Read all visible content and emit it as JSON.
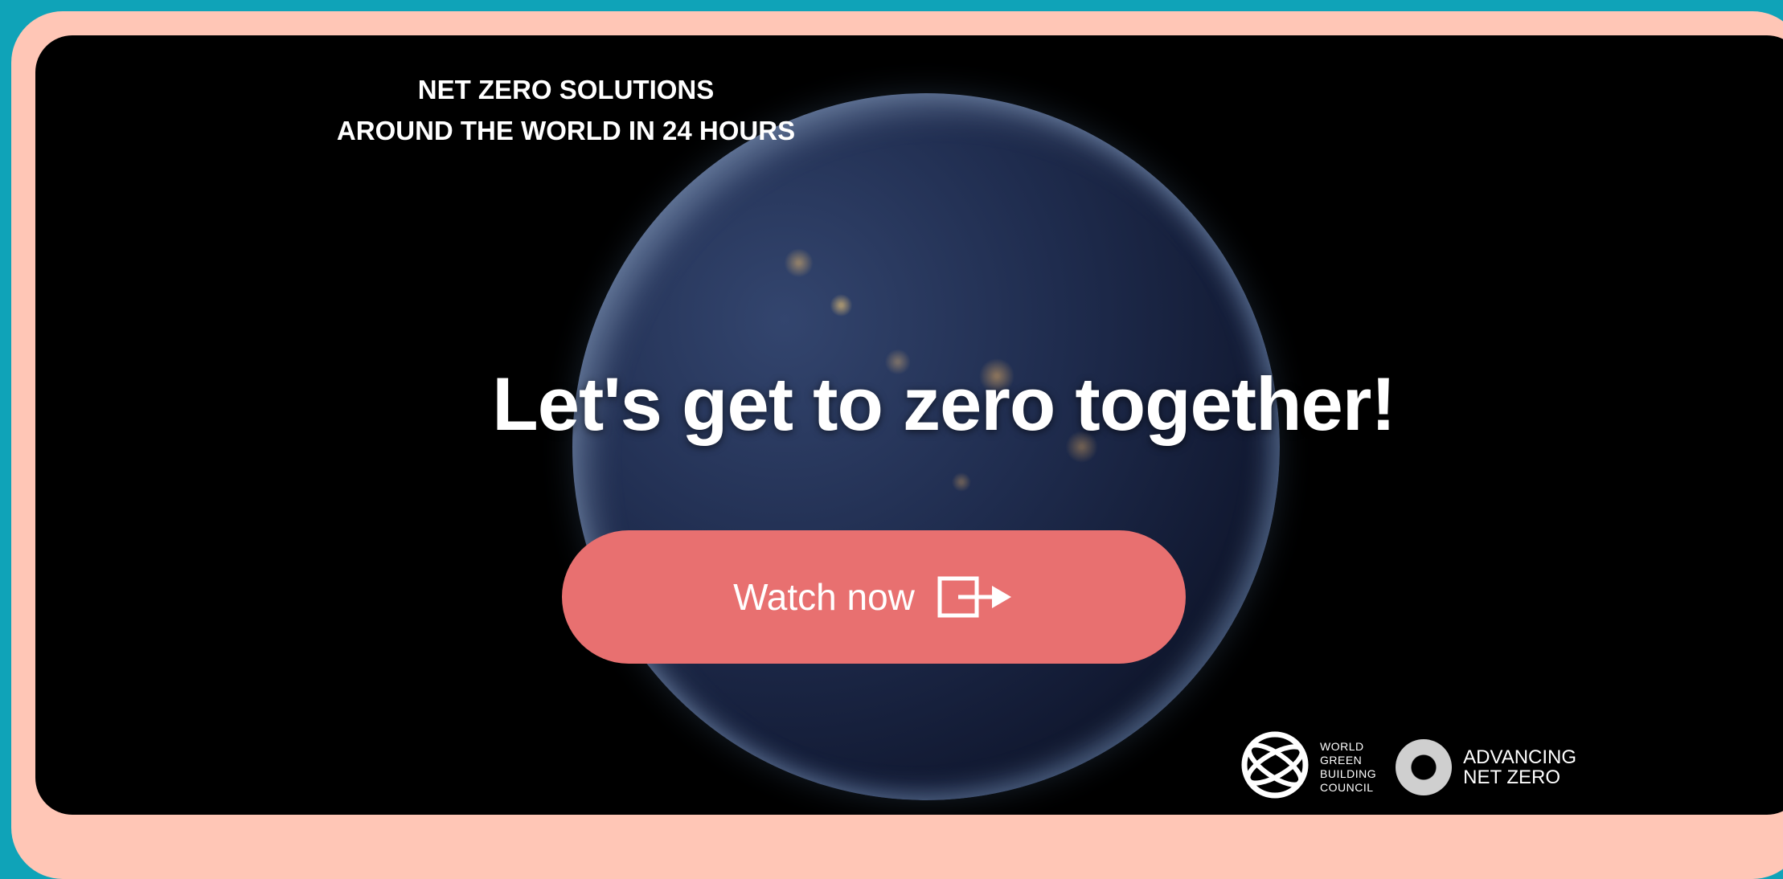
{
  "video": {
    "caption_line1": "NET ZERO SOLUTIONS",
    "caption_line2": "AROUND THE WORLD IN 24 HOURS",
    "headline": "Let's get to zero together!"
  },
  "cta": {
    "label": "Watch now",
    "icon": "enter-arrow-icon",
    "color": "#e87070"
  },
  "logos": {
    "wgbc": [
      "WORLD",
      "GREEN",
      "BUILDING",
      "COUNCIL"
    ],
    "anz_line1": "ADVANCING",
    "anz_line2": "NET ZERO"
  },
  "colors": {
    "background": "#0fa3b8",
    "frame": "#ffc6b6",
    "video_bg": "#000000"
  }
}
